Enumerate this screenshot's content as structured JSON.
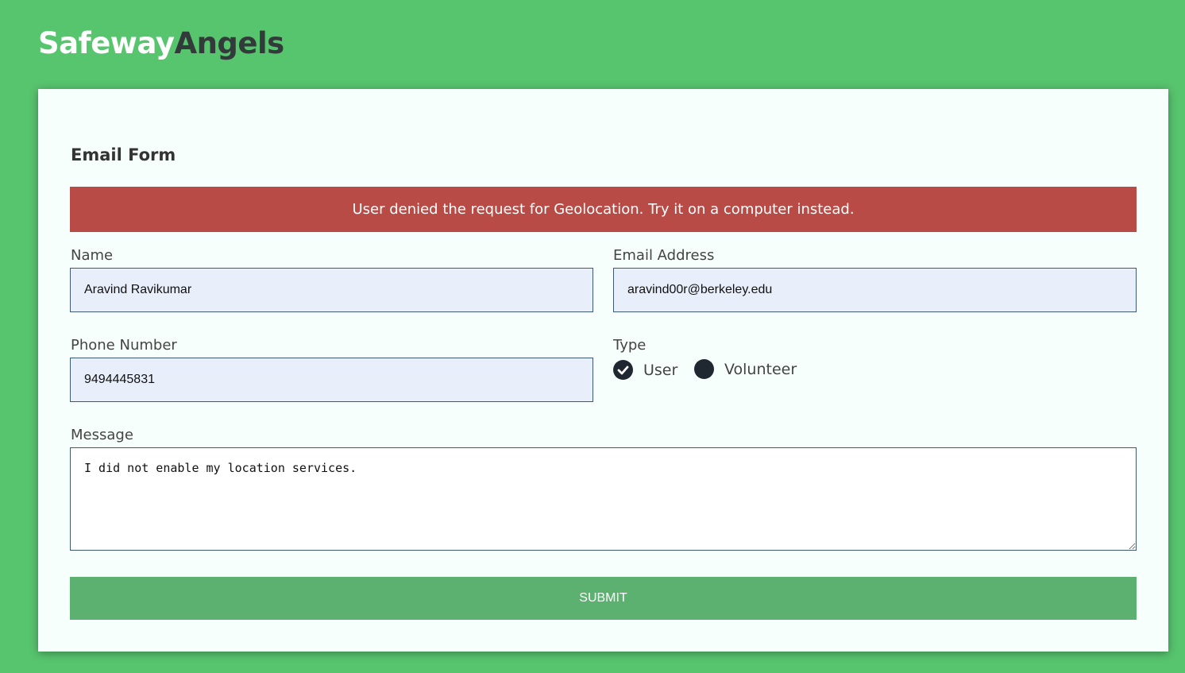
{
  "brand": {
    "part1": "Safeway",
    "part2": "Angels"
  },
  "form": {
    "title": "Email Form",
    "alert": "User denied the request for Geolocation. Try it on a computer instead.",
    "name": {
      "label": "Name",
      "value": "Aravind Ravikumar"
    },
    "email": {
      "label": "Email Address",
      "value": "aravind00r@berkeley.edu"
    },
    "phone": {
      "label": "Phone Number",
      "value": "9494445831"
    },
    "type": {
      "label": "Type",
      "options": [
        {
          "label": "User",
          "selected": true
        },
        {
          "label": "Volunteer",
          "selected": false
        }
      ]
    },
    "message": {
      "label": "Message",
      "value": "I did not enable my location services."
    },
    "submit_label": "SUBMIT"
  },
  "colors": {
    "background": "#57c46e",
    "alert": "#b84b46",
    "submit": "#5db170",
    "card": "#f7fffd",
    "field": "#e8effb"
  }
}
